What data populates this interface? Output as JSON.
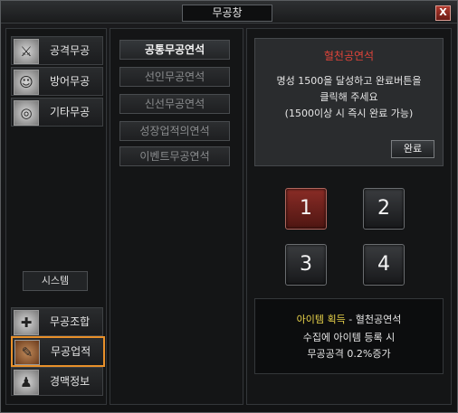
{
  "window": {
    "title": "무공창",
    "close_label": "X"
  },
  "sidebar": {
    "items": [
      {
        "label": "공격무공",
        "icon": "sword-icon"
      },
      {
        "label": "방어무공",
        "icon": "person-icon"
      },
      {
        "label": "기타무공",
        "icon": "swirl-icon"
      }
    ],
    "system_label": "시스템",
    "bottom_items": [
      {
        "label": "무공조합",
        "icon": "combine-icon"
      },
      {
        "label": "무공업적",
        "icon": "scroll-icon",
        "active": true
      },
      {
        "label": "경맥정보",
        "icon": "meridian-icon"
      }
    ]
  },
  "tabs": [
    {
      "label": "공통무공연석",
      "active": true
    },
    {
      "label": "선인무공연석"
    },
    {
      "label": "신선무공연석"
    },
    {
      "label": "성장업적의연석"
    },
    {
      "label": "이벤트무공연석"
    }
  ],
  "info": {
    "title": "혈천공연석",
    "line1": "명성 1500을 달성하고 완료버튼을",
    "line2": "클릭해 주세요",
    "line3": "(1500이상 시 즉시 완료 가능)",
    "done_label": "완료"
  },
  "pages": [
    {
      "label": "1",
      "active": true
    },
    {
      "label": "2"
    },
    {
      "label": "3"
    },
    {
      "label": "4"
    }
  ],
  "reward": {
    "title_highlight": "아이템 획득",
    "title_rest": " - 혈천공연석",
    "line1": "수집에 아이템 등록 시",
    "line2": "무공공격 0.2%증가"
  },
  "colors": {
    "accent_orange": "#e8902a",
    "title_red": "#e0443a",
    "highlight_yellow": "#e8d24a",
    "active_page_red": "#8a2c26"
  }
}
